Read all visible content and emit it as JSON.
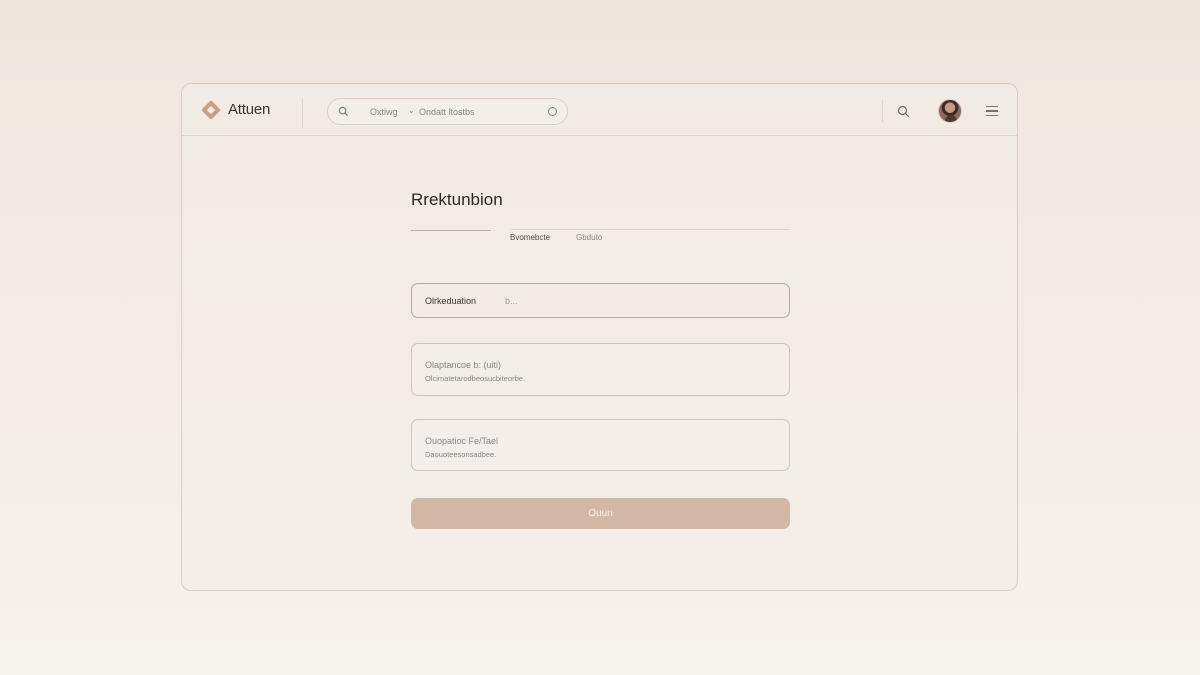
{
  "app": {
    "name": "Attuen",
    "logo_icon": "diamond-logo-icon"
  },
  "header": {
    "search": {
      "scope": "Oxtiwg",
      "scope_chevron": "⌄",
      "placeholder": "Ondatt ltostbs"
    },
    "icons": [
      "search-icon",
      "avatar",
      "menu-icon"
    ]
  },
  "page": {
    "title": "Rrektunbion",
    "tabs": [
      {
        "label": "Bvomebcte"
      },
      {
        "label": "Gbduto"
      }
    ]
  },
  "form": {
    "field_1": {
      "label": "Olrkeduation",
      "value": "b..."
    },
    "field_2": {
      "label": "Olaptancoe b: (uiti)",
      "hint": "Olcimatetarodbeosucbiteorbe."
    },
    "field_3": {
      "label": "Ouopatioc Fe/Tael",
      "hint": "Daouoteesonsadbee."
    },
    "submit_label": "Ouun"
  },
  "colors": {
    "accent": "#d4b8a6",
    "logo": "#c4a187",
    "border": "#d6cdc6"
  }
}
